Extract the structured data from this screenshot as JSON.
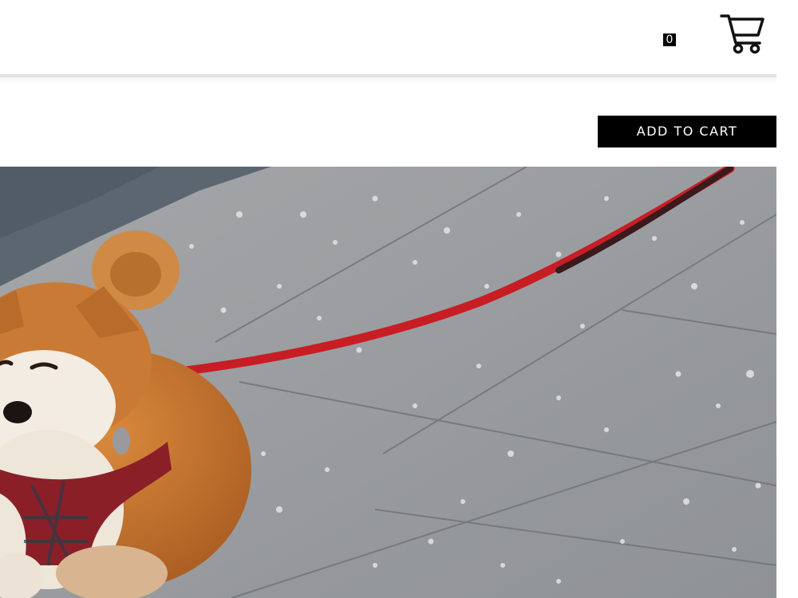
{
  "header": {
    "cart_count": "0",
    "cart_icon": "shopping-cart-icon"
  },
  "product": {
    "add_to_cart_label": "ADD TO CART",
    "image": {
      "subject": "shiba-inu-dog-on-leash-photo"
    }
  },
  "colors": {
    "button_bg": "#000000",
    "button_text": "#ffffff",
    "divider": "#e2e2e2",
    "leash": "#c81d24",
    "pavement": "#9b9ea2",
    "dog_fur": "#c9772e"
  }
}
